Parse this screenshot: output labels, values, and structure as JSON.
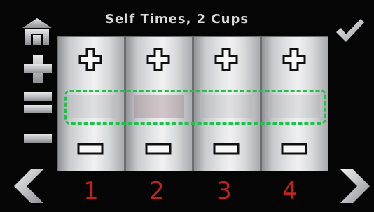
{
  "title": "Self Times, 2 Cups",
  "icons": {
    "home": "home-icon",
    "plus": "plus-icon",
    "equal": "equal-icon",
    "minus": "minus-icon",
    "check": "check-icon",
    "prev": "chevron-left-icon",
    "next": "chevron-right-icon"
  },
  "cups": [
    {
      "number": "1"
    },
    {
      "number": "2"
    },
    {
      "number": "3"
    },
    {
      "number": "4"
    }
  ],
  "colors": {
    "selection": "#1ec24a",
    "cup_number": "#c3211f",
    "title": "#d8d8d8"
  }
}
